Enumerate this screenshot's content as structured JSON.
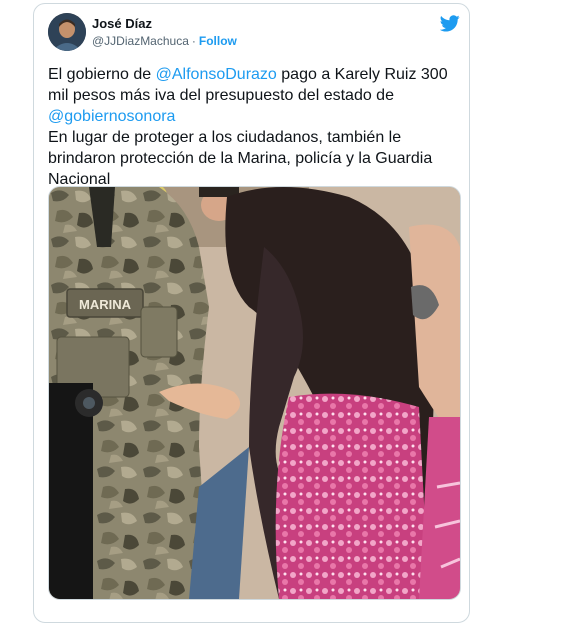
{
  "tweet": {
    "author_name": "José Díaz",
    "handle": "@JJDiazMachuca",
    "separator": "·",
    "follow_label": "Follow",
    "brand_icon": "twitter-bird-icon",
    "brand_color": "#1d9bf0",
    "text": {
      "p1_before": "El gobierno de ",
      "mention1": "@AlfonsoDurazo",
      "p1_after": " pago a Karely Ruiz 300 mil pesos más iva del presupuesto del estado de ",
      "mention2": "@gobiernosonora",
      "p2": "En lugar de proteger a los ciudadanos, también le brindaron protección de la Marina, policía y la Guardia Nacional"
    },
    "media": {
      "patch_text": "MARINA"
    }
  }
}
